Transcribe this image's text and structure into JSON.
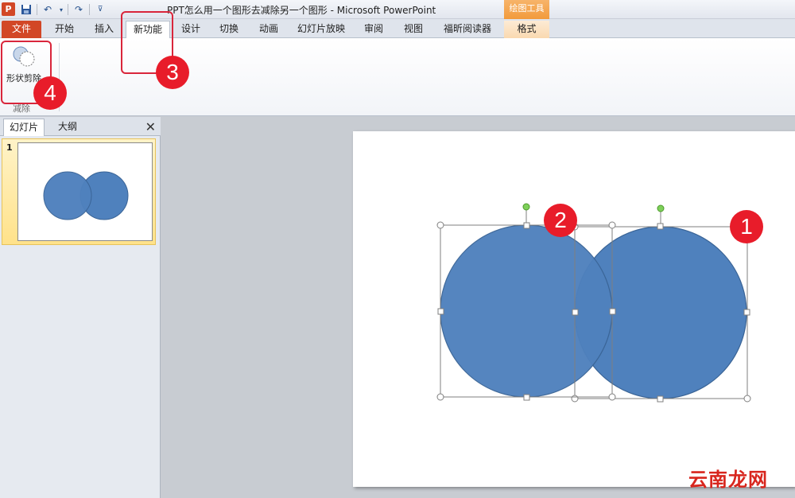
{
  "window": {
    "title": "PPT怎么用一个图形去减除另一个图形 - Microsoft PowerPoint",
    "app_icon_letter": "P",
    "context_tab_group": "绘图工具"
  },
  "quick_access": {
    "icons": [
      "save-icon",
      "undo-icon",
      "dropdown-icon",
      "redo-icon",
      "customize-icon"
    ]
  },
  "ribbon_tabs": [
    {
      "label": "文件"
    },
    {
      "label": "开始"
    },
    {
      "label": "插入"
    },
    {
      "label": "新功能"
    },
    {
      "label": "设计"
    },
    {
      "label": "切换"
    },
    {
      "label": "动画"
    },
    {
      "label": "幻灯片放映"
    },
    {
      "label": "审阅"
    },
    {
      "label": "视图"
    },
    {
      "label": "福昕阅读器"
    },
    {
      "label": "格式"
    }
  ],
  "ribbon": {
    "shape_subtract_label": "形状剪除",
    "group_label": "减除"
  },
  "annotations": [
    "1",
    "2",
    "3",
    "4"
  ],
  "slide_pane": {
    "tabs": [
      "幻灯片",
      "大纲"
    ],
    "close_label": "✕",
    "slide_number": "1"
  },
  "colors": {
    "shape_fill": "#4f81bd",
    "shape_stroke": "#3a6496",
    "annotation_red": "#e81c2a",
    "file_tab": "#d24726"
  },
  "watermark": "云南龙网"
}
